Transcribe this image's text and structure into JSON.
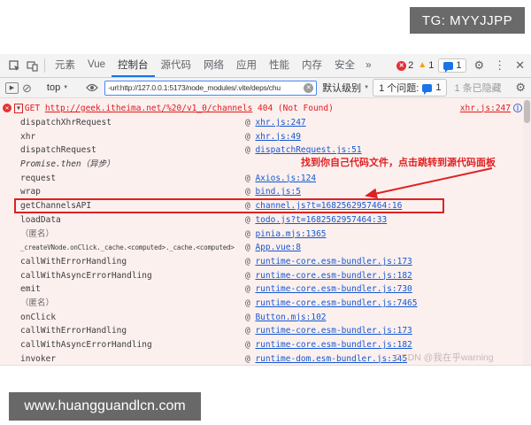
{
  "watermarks": {
    "top_banner": "TG: MYYJJPP",
    "bottom_banner": "www.huangguandlcn.com",
    "console_watermark": "CSDN @我在乎warning"
  },
  "colors": {
    "accent_blue": "#1a73e8",
    "error_red": "#df1b1b",
    "link_blue": "#1558d0",
    "console_bg": "#fcf0ef",
    "annotation_red": "#e02222"
  },
  "devtools": {
    "tabs": {
      "active": "控制台",
      "items": [
        {
          "name": "elements",
          "label": "元素"
        },
        {
          "name": "vue",
          "label": "Vue"
        },
        {
          "name": "console",
          "label": "控制台"
        },
        {
          "name": "sources",
          "label": "源代码"
        },
        {
          "name": "network",
          "label": "网络"
        },
        {
          "name": "application",
          "label": "应用"
        },
        {
          "name": "performance",
          "label": "性能"
        },
        {
          "name": "memory",
          "label": "内存"
        },
        {
          "name": "security",
          "label": "安全"
        }
      ],
      "more_label": "»"
    },
    "badges": {
      "errors": "2",
      "warnings": "1",
      "messages": "1"
    },
    "controls": {
      "settings_icon": "gear-icon",
      "menu_icon": "three-dots-icon",
      "close_icon": "close-icon",
      "close_glyph": "✕",
      "dots_glyph": "⋮",
      "gear_glyph": "⚙"
    },
    "toolbar": {
      "context_value": "top",
      "filter_value": "-url:http://127.0.0.1:5173/node_modules/.vite/deps/chu",
      "levels_label": "默认级别",
      "issues_label": "1 个问题:",
      "issues_count": "1",
      "hidden_label": "1 条已隐藏"
    },
    "console": {
      "error": {
        "method": "GET ",
        "url": "http://geek.itheima.net/%20/v1_0/channels",
        "status": " 404 (Not Found)",
        "source": "xhr.js:247",
        "expand_glyph": "▼"
      },
      "annotation": "找到你自己代码文件，点击跳转到源代码面板",
      "stack": [
        {
          "fn": "dispatchXhrRequest",
          "loc": "xhr.js:247"
        },
        {
          "fn": "xhr",
          "loc": "xhr.js:49"
        },
        {
          "fn": "dispatchRequest",
          "loc": "dispatchRequest.js:51"
        },
        {
          "fn": "Promise.then（异步）",
          "loc": "",
          "italic": true
        },
        {
          "fn": "request",
          "loc": "Axios.js:124"
        },
        {
          "fn": "wrap",
          "loc": "bind.js:5"
        },
        {
          "fn": "getChannelsAPI",
          "loc": "channel.js?t=1682562957464:16",
          "boxed": true
        },
        {
          "fn": "loadData",
          "loc": "todo.js?t=1682562957464:33"
        },
        {
          "fn": "（匿名）",
          "loc": "pinia.mjs:1365",
          "anon": true
        },
        {
          "fn": "_createVNode.onClick._cache.<computed>._cache.<computed>",
          "loc": "App.vue:8"
        },
        {
          "fn": "callWithErrorHandling",
          "loc": "runtime-core.esm-bundler.js:173"
        },
        {
          "fn": "callWithAsyncErrorHandling",
          "loc": "runtime-core.esm-bundler.js:182"
        },
        {
          "fn": "emit",
          "loc": "runtime-core.esm-bundler.js:730"
        },
        {
          "fn": "（匿名）",
          "loc": "runtime-core.esm-bundler.js:7465",
          "anon": true
        },
        {
          "fn": "onClick",
          "loc": "Button.mjs:102"
        },
        {
          "fn": "callWithErrorHandling",
          "loc": "runtime-core.esm-bundler.js:173"
        },
        {
          "fn": "callWithAsyncErrorHandling",
          "loc": "runtime-core.esm-bundler.js:182"
        },
        {
          "fn": "invoker",
          "loc": "runtime-dom.esm-bundler.js:345"
        }
      ]
    }
  }
}
